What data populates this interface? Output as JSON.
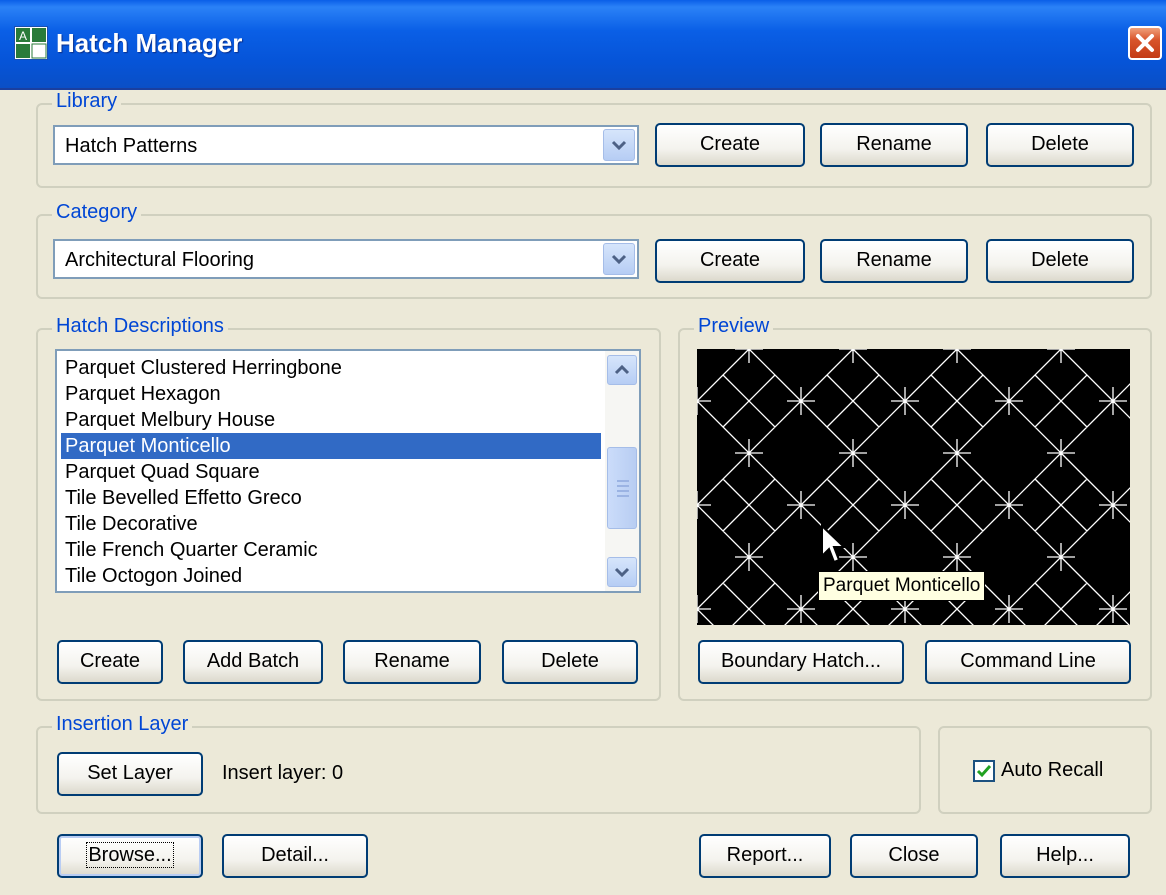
{
  "window": {
    "title": "Hatch Manager"
  },
  "library": {
    "legend": "Library",
    "selected": "Hatch Patterns",
    "create_label": "Create",
    "rename_label": "Rename",
    "delete_label": "Delete"
  },
  "category": {
    "legend": "Category",
    "selected": "Architectural Flooring",
    "create_label": "Create",
    "rename_label": "Rename",
    "delete_label": "Delete"
  },
  "descriptions": {
    "legend": "Hatch Descriptions",
    "items": [
      "Parquet Clustered Herringbone",
      "Parquet Hexagon",
      "Parquet Melbury House",
      "Parquet Monticello",
      "Parquet Quad Square",
      "Tile Bevelled Effetto Greco",
      "Tile Decorative",
      "Tile French Quarter Ceramic",
      "Tile Octogon Joined"
    ],
    "selected_index": 3,
    "create_label": "Create",
    "add_batch_label": "Add Batch",
    "rename_label": "Rename",
    "delete_label": "Delete"
  },
  "preview": {
    "legend": "Preview",
    "tooltip": "Parquet Monticello",
    "boundary_hatch_label": "Boundary Hatch...",
    "command_line_label": "Command Line"
  },
  "insertion": {
    "legend": "Insertion Layer",
    "set_layer_label": "Set Layer",
    "insert_layer_text": "Insert layer: 0"
  },
  "auto_recall": {
    "label": "Auto Recall",
    "checked": true
  },
  "footer": {
    "browse_label": "Browse...",
    "detail_label": "Detail...",
    "report_label": "Report...",
    "close_label": "Close",
    "help_label": "Help..."
  },
  "colors": {
    "title_bar": "#0a5fe6",
    "legend_text": "#0046d5",
    "selection": "#316ac5",
    "dialog_bg": "#ece9d8"
  }
}
